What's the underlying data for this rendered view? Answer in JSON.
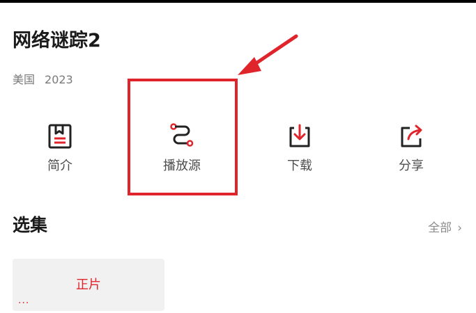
{
  "title": "网络谜踪2",
  "meta": {
    "country": "美国",
    "year": "2023"
  },
  "actions": [
    {
      "label": "简介",
      "icon": "book-icon"
    },
    {
      "label": "播放源",
      "icon": "route-icon"
    },
    {
      "label": "下载",
      "icon": "download-icon"
    },
    {
      "label": "分享",
      "icon": "share-icon"
    }
  ],
  "episodes": {
    "section_title": "选集",
    "view_all": "全部",
    "items": [
      {
        "label": "正片",
        "indicator": "···"
      }
    ]
  },
  "colors": {
    "accent": "#e0242b",
    "text": "#1a1a1a",
    "muted": "#7a7a7a",
    "card_bg": "#f1f1f1"
  }
}
